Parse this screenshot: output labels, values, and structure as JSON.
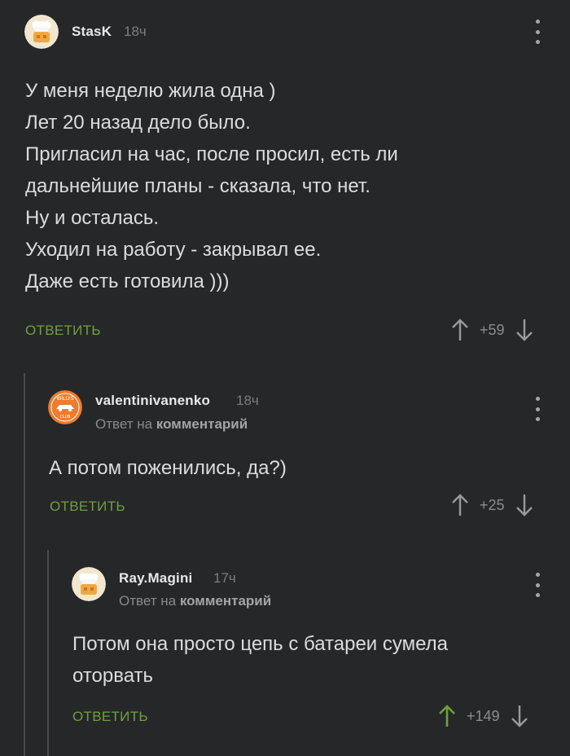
{
  "comments": [
    {
      "username": "StasK",
      "time": "18ч",
      "reply_prefix": "",
      "reply_target": "",
      "lines": "У меня неделю жила одна )\nЛет 20 назад дело было.\nПригласил на час, после просил, есть ли\nдальнейшие планы - сказала, что нет.\nНу и осталась.\nУходил на работу - закрывал ее.\nДаже есть готовила )))",
      "reply_label": "ОТВЕТИТЬ",
      "score": "+59",
      "upvoted": false
    },
    {
      "username": "valentinivanenko",
      "time": "18ч",
      "reply_prefix": "Ответ на",
      "reply_target": "комментарий",
      "lines": "А потом поженились, да?)",
      "reply_label": "ОТВЕТИТЬ",
      "score": "+25",
      "upvoted": false,
      "avatar_text_top": "WILLYS",
      "avatar_text_bottom": "CLUB"
    },
    {
      "username": "Ray.Magini",
      "time": "17ч",
      "reply_prefix": "Ответ на",
      "reply_target": "комментарий",
      "lines": "Потом она просто цепь с батареи сумела\nоторвать",
      "reply_label": "ОТВЕТИТЬ",
      "score": "+149",
      "upvoted": true
    }
  ],
  "colors": {
    "background": "#262729",
    "accent_green": "#6ea03f",
    "thread_line": "#4a4b4d",
    "arrow_default": "#9a9a9a"
  }
}
